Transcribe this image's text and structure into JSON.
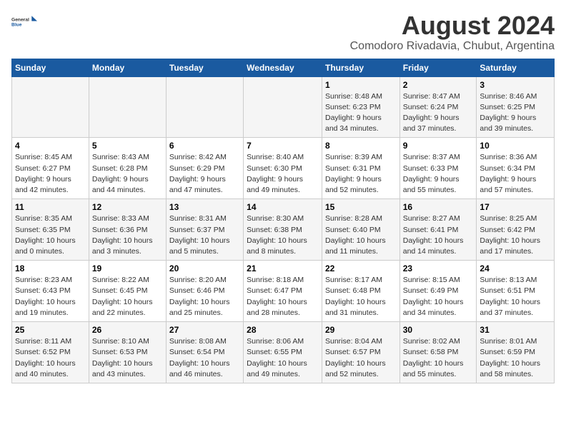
{
  "logo": {
    "line1": "General",
    "line2": "Blue"
  },
  "title": "August 2024",
  "subtitle": "Comodoro Rivadavia, Chubut, Argentina",
  "days_of_week": [
    "Sunday",
    "Monday",
    "Tuesday",
    "Wednesday",
    "Thursday",
    "Friday",
    "Saturday"
  ],
  "weeks": [
    [
      {
        "day": "",
        "info": ""
      },
      {
        "day": "",
        "info": ""
      },
      {
        "day": "",
        "info": ""
      },
      {
        "day": "",
        "info": ""
      },
      {
        "day": "1",
        "info": "Sunrise: 8:48 AM\nSunset: 6:23 PM\nDaylight: 9 hours\nand 34 minutes."
      },
      {
        "day": "2",
        "info": "Sunrise: 8:47 AM\nSunset: 6:24 PM\nDaylight: 9 hours\nand 37 minutes."
      },
      {
        "day": "3",
        "info": "Sunrise: 8:46 AM\nSunset: 6:25 PM\nDaylight: 9 hours\nand 39 minutes."
      }
    ],
    [
      {
        "day": "4",
        "info": "Sunrise: 8:45 AM\nSunset: 6:27 PM\nDaylight: 9 hours\nand 42 minutes."
      },
      {
        "day": "5",
        "info": "Sunrise: 8:43 AM\nSunset: 6:28 PM\nDaylight: 9 hours\nand 44 minutes."
      },
      {
        "day": "6",
        "info": "Sunrise: 8:42 AM\nSunset: 6:29 PM\nDaylight: 9 hours\nand 47 minutes."
      },
      {
        "day": "7",
        "info": "Sunrise: 8:40 AM\nSunset: 6:30 PM\nDaylight: 9 hours\nand 49 minutes."
      },
      {
        "day": "8",
        "info": "Sunrise: 8:39 AM\nSunset: 6:31 PM\nDaylight: 9 hours\nand 52 minutes."
      },
      {
        "day": "9",
        "info": "Sunrise: 8:37 AM\nSunset: 6:33 PM\nDaylight: 9 hours\nand 55 minutes."
      },
      {
        "day": "10",
        "info": "Sunrise: 8:36 AM\nSunset: 6:34 PM\nDaylight: 9 hours\nand 57 minutes."
      }
    ],
    [
      {
        "day": "11",
        "info": "Sunrise: 8:35 AM\nSunset: 6:35 PM\nDaylight: 10 hours\nand 0 minutes."
      },
      {
        "day": "12",
        "info": "Sunrise: 8:33 AM\nSunset: 6:36 PM\nDaylight: 10 hours\nand 3 minutes."
      },
      {
        "day": "13",
        "info": "Sunrise: 8:31 AM\nSunset: 6:37 PM\nDaylight: 10 hours\nand 5 minutes."
      },
      {
        "day": "14",
        "info": "Sunrise: 8:30 AM\nSunset: 6:38 PM\nDaylight: 10 hours\nand 8 minutes."
      },
      {
        "day": "15",
        "info": "Sunrise: 8:28 AM\nSunset: 6:40 PM\nDaylight: 10 hours\nand 11 minutes."
      },
      {
        "day": "16",
        "info": "Sunrise: 8:27 AM\nSunset: 6:41 PM\nDaylight: 10 hours\nand 14 minutes."
      },
      {
        "day": "17",
        "info": "Sunrise: 8:25 AM\nSunset: 6:42 PM\nDaylight: 10 hours\nand 17 minutes."
      }
    ],
    [
      {
        "day": "18",
        "info": "Sunrise: 8:23 AM\nSunset: 6:43 PM\nDaylight: 10 hours\nand 19 minutes."
      },
      {
        "day": "19",
        "info": "Sunrise: 8:22 AM\nSunset: 6:45 PM\nDaylight: 10 hours\nand 22 minutes."
      },
      {
        "day": "20",
        "info": "Sunrise: 8:20 AM\nSunset: 6:46 PM\nDaylight: 10 hours\nand 25 minutes."
      },
      {
        "day": "21",
        "info": "Sunrise: 8:18 AM\nSunset: 6:47 PM\nDaylight: 10 hours\nand 28 minutes."
      },
      {
        "day": "22",
        "info": "Sunrise: 8:17 AM\nSunset: 6:48 PM\nDaylight: 10 hours\nand 31 minutes."
      },
      {
        "day": "23",
        "info": "Sunrise: 8:15 AM\nSunset: 6:49 PM\nDaylight: 10 hours\nand 34 minutes."
      },
      {
        "day": "24",
        "info": "Sunrise: 8:13 AM\nSunset: 6:51 PM\nDaylight: 10 hours\nand 37 minutes."
      }
    ],
    [
      {
        "day": "25",
        "info": "Sunrise: 8:11 AM\nSunset: 6:52 PM\nDaylight: 10 hours\nand 40 minutes."
      },
      {
        "day": "26",
        "info": "Sunrise: 8:10 AM\nSunset: 6:53 PM\nDaylight: 10 hours\nand 43 minutes."
      },
      {
        "day": "27",
        "info": "Sunrise: 8:08 AM\nSunset: 6:54 PM\nDaylight: 10 hours\nand 46 minutes."
      },
      {
        "day": "28",
        "info": "Sunrise: 8:06 AM\nSunset: 6:55 PM\nDaylight: 10 hours\nand 49 minutes."
      },
      {
        "day": "29",
        "info": "Sunrise: 8:04 AM\nSunset: 6:57 PM\nDaylight: 10 hours\nand 52 minutes."
      },
      {
        "day": "30",
        "info": "Sunrise: 8:02 AM\nSunset: 6:58 PM\nDaylight: 10 hours\nand 55 minutes."
      },
      {
        "day": "31",
        "info": "Sunrise: 8:01 AM\nSunset: 6:59 PM\nDaylight: 10 hours\nand 58 minutes."
      }
    ]
  ]
}
